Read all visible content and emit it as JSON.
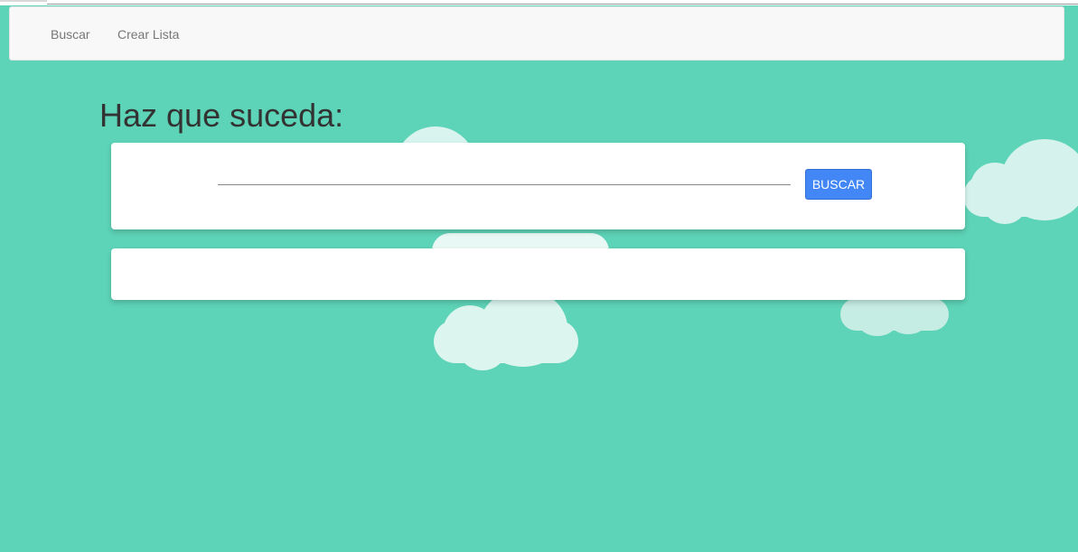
{
  "navbar": {
    "links": [
      {
        "label": "Buscar"
      },
      {
        "label": "Crear Lista"
      }
    ]
  },
  "page": {
    "title": "Haz que suceda:"
  },
  "search": {
    "value": "",
    "placeholder": "",
    "button_label": "BUSCAR"
  },
  "results": {
    "items": []
  },
  "colors": {
    "background": "#5dd3b7",
    "button": "#4287f5",
    "cloud": "#dbf4ee"
  }
}
